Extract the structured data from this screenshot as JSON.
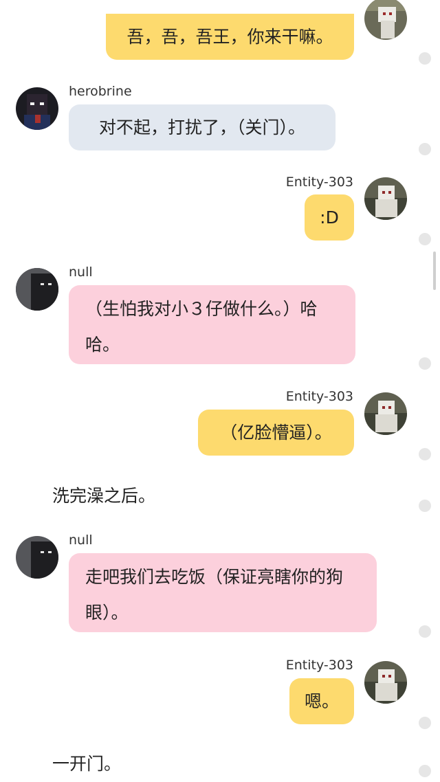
{
  "messages": [
    {
      "sender": "",
      "side": "right",
      "text": "吾，吾，吾王，你来干嘛。"
    },
    {
      "sender": "herobrine",
      "side": "left",
      "text": "对不起，打扰了，（关门）。"
    },
    {
      "sender": "Entity-303",
      "side": "right",
      "text": ":D"
    },
    {
      "sender": "null",
      "side": "left",
      "text_line1": "（生怕我对小３仔做什么。）哈",
      "text_line2": "哈。"
    },
    {
      "sender": "Entity-303",
      "side": "right",
      "text": "（亿脸懵逼）。"
    },
    {
      "narration": "洗完澡之后。"
    },
    {
      "sender": "null",
      "side": "left",
      "text_line1": "走吧我们去吃饭（保证亮瞎你的狗",
      "text_line2": "眼）。"
    },
    {
      "sender": "Entity-303",
      "side": "right",
      "text": "嗯。"
    },
    {
      "narration": "一开门。"
    }
  ],
  "colors": {
    "right_bubble": "#fdda6e",
    "herobrine_bubble": "#e2e8f0",
    "null_bubble": "#fcd0dc",
    "side_dot": "#e6e6e6"
  },
  "icons": {
    "entity_avatar": "entity-303-avatar-icon",
    "herobrine_avatar": "herobrine-avatar-icon",
    "null_avatar": "null-avatar-icon"
  }
}
